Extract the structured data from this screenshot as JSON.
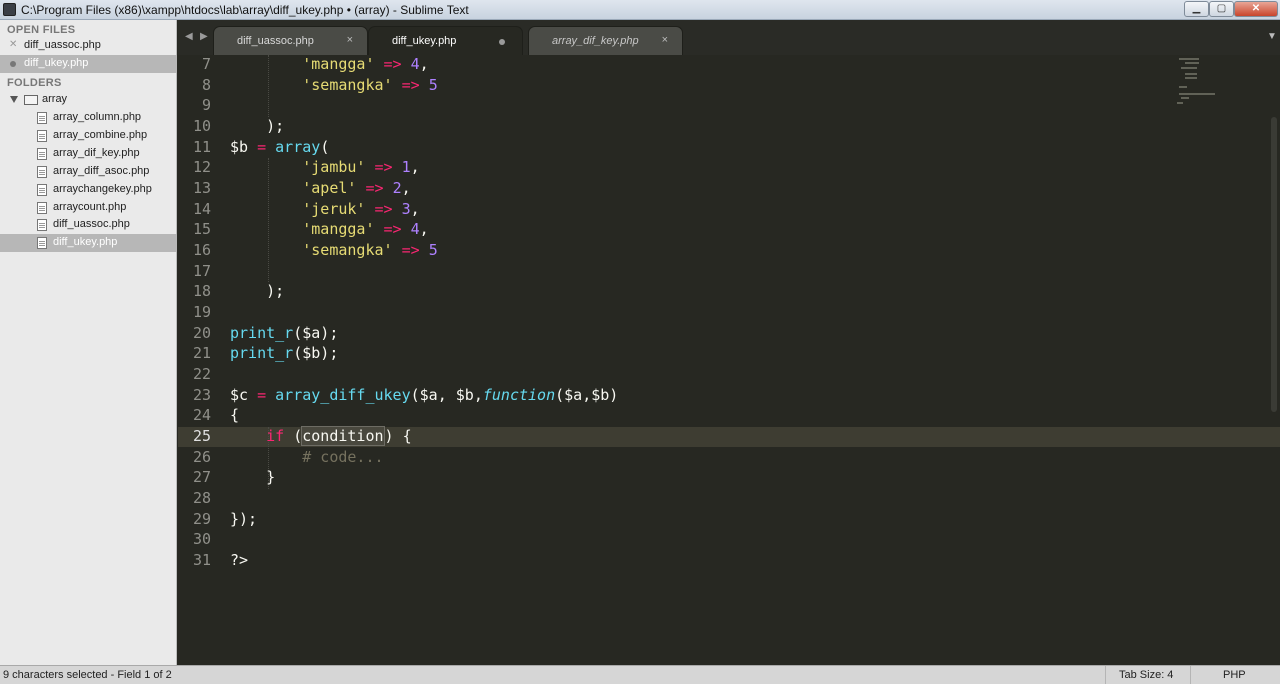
{
  "window": {
    "title": "C:\\Program Files (x86)\\xampp\\htdocs\\lab\\array\\diff_ukey.php • (array) - Sublime Text",
    "min_glyph": "▁",
    "max_glyph": "▢",
    "close_glyph": "✕"
  },
  "sidebar": {
    "open_files_header": "OPEN FILES",
    "open_files": [
      {
        "label": "diff_uassoc.php"
      },
      {
        "label": "diff_ukey.php"
      }
    ],
    "folders_header": "FOLDERS",
    "folder": {
      "label": "array"
    },
    "files": [
      {
        "label": "array_column.php"
      },
      {
        "label": "array_combine.php"
      },
      {
        "label": "array_dif_key.php"
      },
      {
        "label": "array_diff_asoc.php"
      },
      {
        "label": "arraychangekey.php"
      },
      {
        "label": "arraycount.php"
      },
      {
        "label": "diff_uassoc.php"
      },
      {
        "label": "diff_ukey.php"
      }
    ]
  },
  "tabs": {
    "prev_glyph": "◀",
    "next_glyph": "▶",
    "menu_glyph": "▼",
    "close_glyph": "×",
    "items": [
      {
        "label": "diff_uassoc.php"
      },
      {
        "label": "diff_ukey.php"
      },
      {
        "label": "array_dif_key.php"
      }
    ]
  },
  "editor": {
    "line_numbers": [
      "7",
      "8",
      "9",
      "10",
      "11",
      "12",
      "13",
      "14",
      "15",
      "16",
      "17",
      "18",
      "19",
      "20",
      "21",
      "22",
      "23",
      "24",
      "25",
      "26",
      "27",
      "28",
      "29",
      "30",
      "31"
    ],
    "current_line": "25",
    "tokens": {
      "mangga": "'mangga'",
      "semangka": "'semangka'",
      "jambu": "'jambu'",
      "apel": "'apel'",
      "jeruk": "'jeruk'",
      "arrow": "=>",
      "n1": "1",
      "n2": "2",
      "n3": "3",
      "n4": "4",
      "n5": "5",
      "comma": ",",
      "close_array": ");",
      "var_b": "$b",
      "var_c": "$c",
      "eq": "=",
      "array_fn": "array",
      "open_paren": "(",
      "print_r": "print_r",
      "arg_a": "($a);",
      "arg_b": "($b);",
      "array_diff_ukey": "array_diff_ukey",
      "args_ab": "($a, $b,",
      "function_kw": "function",
      "params": "($a,$b)",
      "open_brace": "{",
      "if_kw": "if",
      "paren_open_sp": " (",
      "condition": "condition",
      "paren_brace": ") {",
      "comment": "# code...",
      "close_brace": "}",
      "close_fn": "});",
      "php_close": "?>"
    }
  },
  "status": {
    "selection": "9 characters selected - Field 1 of 2",
    "tab_size": "Tab Size: 4",
    "syntax": "PHP"
  }
}
